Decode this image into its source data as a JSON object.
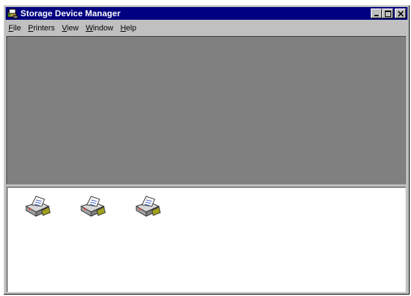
{
  "window": {
    "title": "Storage Device Manager",
    "colors": {
      "titlebar": "#000080",
      "face": "#c0c0c0",
      "top_pane": "#808080",
      "bottom_pane": "#ffffff"
    }
  },
  "title_buttons": [
    "minimize",
    "maximize",
    "close"
  ],
  "menu": [
    {
      "mnemonic": "F",
      "rest": "ile"
    },
    {
      "mnemonic": "P",
      "rest": "rinters"
    },
    {
      "mnemonic": "V",
      "rest": "iew"
    },
    {
      "mnemonic": "W",
      "rest": "indow"
    },
    {
      "mnemonic": "H",
      "rest": "elp"
    }
  ],
  "devices": [
    {
      "icon": "printer-icon"
    },
    {
      "icon": "printer-icon"
    },
    {
      "icon": "printer-icon"
    }
  ]
}
